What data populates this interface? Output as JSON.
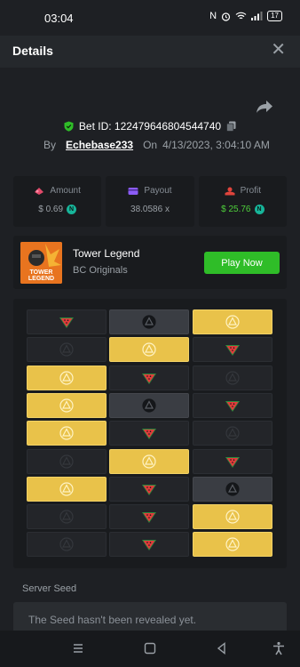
{
  "status_bar": {
    "time": "03:04",
    "network": "N",
    "battery": "17"
  },
  "header": {
    "title": "Details",
    "close_icon": "close-icon"
  },
  "bet": {
    "bet_id_label": "Bet ID: 122479646804544740",
    "by_label": "By",
    "username": "Echebase233",
    "on_label": "On",
    "timestamp": "4/13/2023, 3:04:10 AM"
  },
  "stats": {
    "amount_label": "Amount",
    "amount_value": "$ 0.69",
    "payout_label": "Payout",
    "payout_value": "38.0586 x",
    "profit_label": "Profit",
    "profit_value": "$ 25.76"
  },
  "game": {
    "thumb_text_1": "TOWER",
    "thumb_text_2": "LEGEND",
    "title": "Tower Legend",
    "subtitle": "BC Originals",
    "play_label": "Play Now"
  },
  "board": {
    "rows": [
      [
        {
          "t": "dark",
          "i": "melon"
        },
        {
          "t": "gray",
          "i": "bomb"
        },
        {
          "t": "yellow",
          "i": "bomb"
        }
      ],
      [
        {
          "t": "dark",
          "i": "bomb"
        },
        {
          "t": "yellow",
          "i": "bomb"
        },
        {
          "t": "dark",
          "i": "melon"
        }
      ],
      [
        {
          "t": "yellow",
          "i": "bomb"
        },
        {
          "t": "dark",
          "i": "melon"
        },
        {
          "t": "dark",
          "i": "bomb"
        }
      ],
      [
        {
          "t": "yellow",
          "i": "bomb"
        },
        {
          "t": "gray",
          "i": "bomb"
        },
        {
          "t": "dark",
          "i": "melon"
        }
      ],
      [
        {
          "t": "yellow",
          "i": "bomb"
        },
        {
          "t": "dark",
          "i": "melon"
        },
        {
          "t": "dark",
          "i": "bomb"
        }
      ],
      [
        {
          "t": "dark",
          "i": "bomb"
        },
        {
          "t": "yellow",
          "i": "bomb"
        },
        {
          "t": "dark",
          "i": "melon"
        }
      ],
      [
        {
          "t": "yellow",
          "i": "bomb"
        },
        {
          "t": "dark",
          "i": "melon"
        },
        {
          "t": "gray",
          "i": "bomb"
        }
      ],
      [
        {
          "t": "dark",
          "i": "bomb"
        },
        {
          "t": "dark",
          "i": "melon"
        },
        {
          "t": "yellow",
          "i": "bomb"
        }
      ],
      [
        {
          "t": "dark",
          "i": "bomb"
        },
        {
          "t": "dark",
          "i": "melon"
        },
        {
          "t": "yellow",
          "i": "bomb"
        }
      ]
    ]
  },
  "seed": {
    "label": "Server Seed",
    "text": "The Seed hasn't been revealed yet."
  },
  "colors": {
    "accent_green": "#2fbd28",
    "tile_yellow": "#e9c24a",
    "coin_teal": "#17b59a"
  }
}
